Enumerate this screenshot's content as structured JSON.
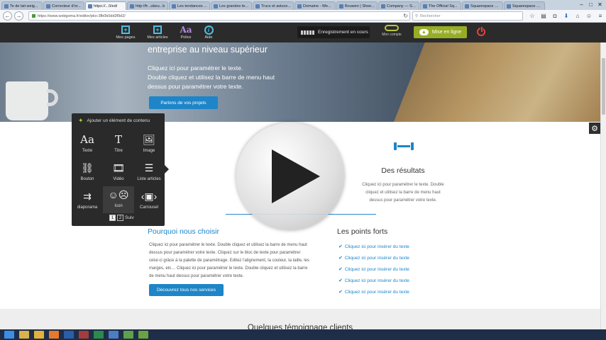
{
  "browser": {
    "tabs": [
      {
        "label": "Te de lait weig...",
        "active": false
      },
      {
        "label": "Correcteur d'or...",
        "active": false
      },
      {
        "label": "https://...0/ed/",
        "active": true
      },
      {
        "label": "http://fr...ubeu...b",
        "active": false
      },
      {
        "label": "Les tendances ...",
        "active": false
      },
      {
        "label": "Les grandes ten...",
        "active": false
      },
      {
        "label": "Trucs et astuce...",
        "active": false
      },
      {
        "label": "Domaine - We...",
        "active": false
      },
      {
        "label": "Bouwen | Shee...",
        "active": false
      },
      {
        "label": "Company — Sq...",
        "active": false
      },
      {
        "label": "The Official Sq...",
        "active": false
      },
      {
        "label": "Squarespace Cl...",
        "active": false
      },
      {
        "label": "Squarespace H...",
        "active": false
      }
    ],
    "url": "https://www.wxbgoma.fr/editor/pko-3fb0b0dd3f9d2/",
    "search_placeholder": "Rechercher"
  },
  "editor": {
    "items": [
      {
        "label": "Mes pages",
        "icon": "+"
      },
      {
        "label": "Mes articles",
        "icon": "+"
      },
      {
        "label": "Police",
        "icon": "Aa"
      },
      {
        "label": "Aide",
        "icon": "i"
      }
    ],
    "save_status": "Enregistrement en cours",
    "account_label": "Mon compte",
    "publish_label": "Mise en ligne",
    "accent_color": "#97ad25"
  },
  "hero": {
    "title": "entreprise au niveau supérieur",
    "text_lines": [
      "Cliquez ici pour paramétrer le texte.",
      "Double cliquez et utilisez la barre de menu haut",
      "dessus pour paramétrer votre texte."
    ],
    "button": "Parlons de vos projets"
  },
  "add_panel": {
    "header": "Ajouter un élément de contenu",
    "items": [
      {
        "label": "Texte",
        "icon": "Aa"
      },
      {
        "label": "Titre",
        "icon": "T"
      },
      {
        "label": "Image",
        "icon": "image-icon"
      },
      {
        "label": "Bouton",
        "icon": "link-icon"
      },
      {
        "label": "Vidéo",
        "icon": "film-icon"
      },
      {
        "label": "Liste articles",
        "icon": "list-icon"
      },
      {
        "label": "diaporama",
        "icon": "slideshow-icon"
      },
      {
        "label": "Icon",
        "icon": "masks-icon"
      },
      {
        "label": "Carrousel",
        "icon": "carousel-icon"
      }
    ],
    "pages": [
      "1",
      "2"
    ],
    "next": "Suiv"
  },
  "results": {
    "title": "Des résultats",
    "text_lines": [
      "Cliquez ici pour paramétrer le texte. Double",
      "cliquez et utilisez la barre de menu haut",
      "dessus pour paramétrer votre texte."
    ]
  },
  "why": {
    "title": "Pourquoi nous choisir",
    "text_lines": [
      "Cliquez ici pour paramétrer le texte. Double cliquez et utilisez la barre de menu haut",
      "dessus pour paramétrer votre texte. Cliquez sur le bloc de texte pour paramétrer",
      "celui-ci grâce à la palette de paramétrage. Editez l'alignement, la couleur, la taille, les",
      "marges, etc… Cliquez ici pour paramétrer le texte. Double cliquez et utilisez la barre",
      "de menu haut dessus pour paramétrer votre texte."
    ],
    "button": "Découvrez tous nos services"
  },
  "points": {
    "title": "Les points forts",
    "items": [
      "Cliquez ici pour insérer du texte",
      "Cliquez ici pour insérer du texte",
      "Cliquez ici pour insérer du texte",
      "Cliquez ici pour insérer du texte",
      "Cliquez ici pour insérer du texte"
    ]
  },
  "testimonials": {
    "title": "Quelques témoignage clients"
  },
  "taskbar": {
    "icons": [
      "windows-explorer-icon",
      "folder-icon",
      "chrome-icon",
      "firefox-icon",
      "photoshop-icon",
      "video-icon",
      "spreadsheet-icon",
      "app-icon",
      "app-icon",
      "app-icon"
    ]
  }
}
